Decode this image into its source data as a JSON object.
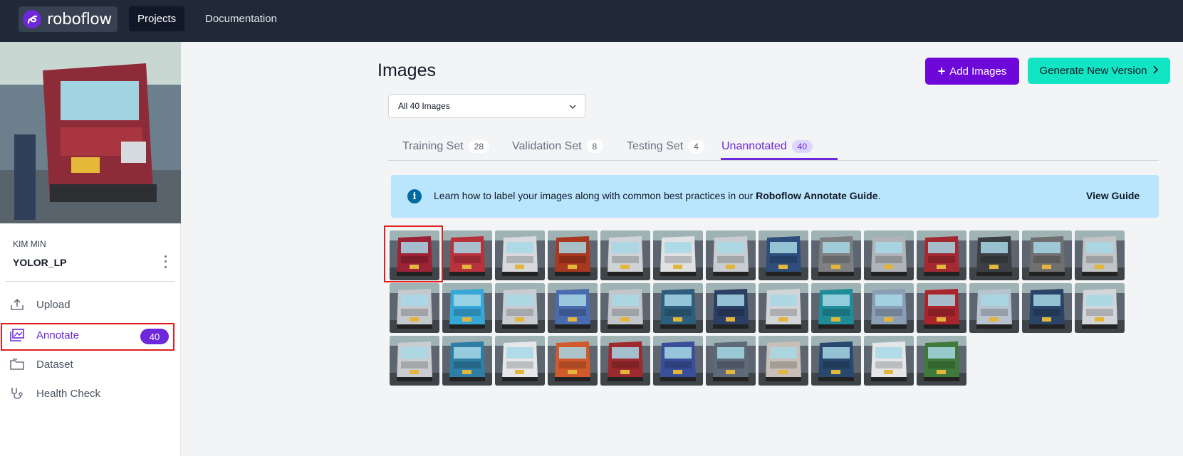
{
  "nav": {
    "brand": "roboflow",
    "projects_label": "Projects",
    "docs_label": "Documentation"
  },
  "sidebar": {
    "owner": "KIM MIN",
    "project": "YOLOR_LP",
    "items": [
      {
        "label": "Upload",
        "icon": "upload-icon"
      },
      {
        "label": "Annotate",
        "icon": "annotate-icon",
        "badge": "40"
      },
      {
        "label": "Dataset",
        "icon": "folder-icon"
      },
      {
        "label": "Health Check",
        "icon": "stethoscope-icon"
      }
    ]
  },
  "main": {
    "title": "Images",
    "add_images": "Add Images",
    "generate": "Generate New Version",
    "filter": "All 40 Images",
    "tabs": [
      {
        "label": "Training Set",
        "count": "28"
      },
      {
        "label": "Validation Set",
        "count": "8"
      },
      {
        "label": "Testing Set",
        "count": "4"
      },
      {
        "label": "Unannotated",
        "count": "40"
      }
    ],
    "banner": {
      "text_before": "Learn how to label your images along with common best practices in our ",
      "text_bold": "Roboflow Annotate Guide",
      "text_after": ".",
      "link": "View Guide"
    }
  },
  "colors": {
    "accent": "#6d28d9",
    "generate": "#12e5c4",
    "highlight": "#e11d1d"
  },
  "thumbnail_colors": [
    "#9b2335",
    "#b8323c",
    "#d7d9dc",
    "#a8381f",
    "#cfd2d6",
    "#dfe1e3",
    "#c9ccd0",
    "#2f4d7a",
    "#7d7f80",
    "#b0b4b8",
    "#a32a33",
    "#3c3f44",
    "#6f6f70",
    "#c2c4c6",
    "#c5c8cc",
    "#37a7d8",
    "#c8ccd1",
    "#4a6bb0",
    "#c2c6cb",
    "#2e5e7d",
    "#2b3e63",
    "#d2d5d8",
    "#1f8c99",
    "#8a9fb5",
    "#a8252c",
    "#b7c3cf",
    "#2a4468",
    "#d3d5d8",
    "#c9cdd1",
    "#2f7ea6",
    "#e6e7e8",
    "#d05a2c",
    "#9c2a2f",
    "#3a4f9a",
    "#5f6a78",
    "#c8c0b8",
    "#29486e",
    "#e5e6e7",
    "#3f7a3a"
  ]
}
